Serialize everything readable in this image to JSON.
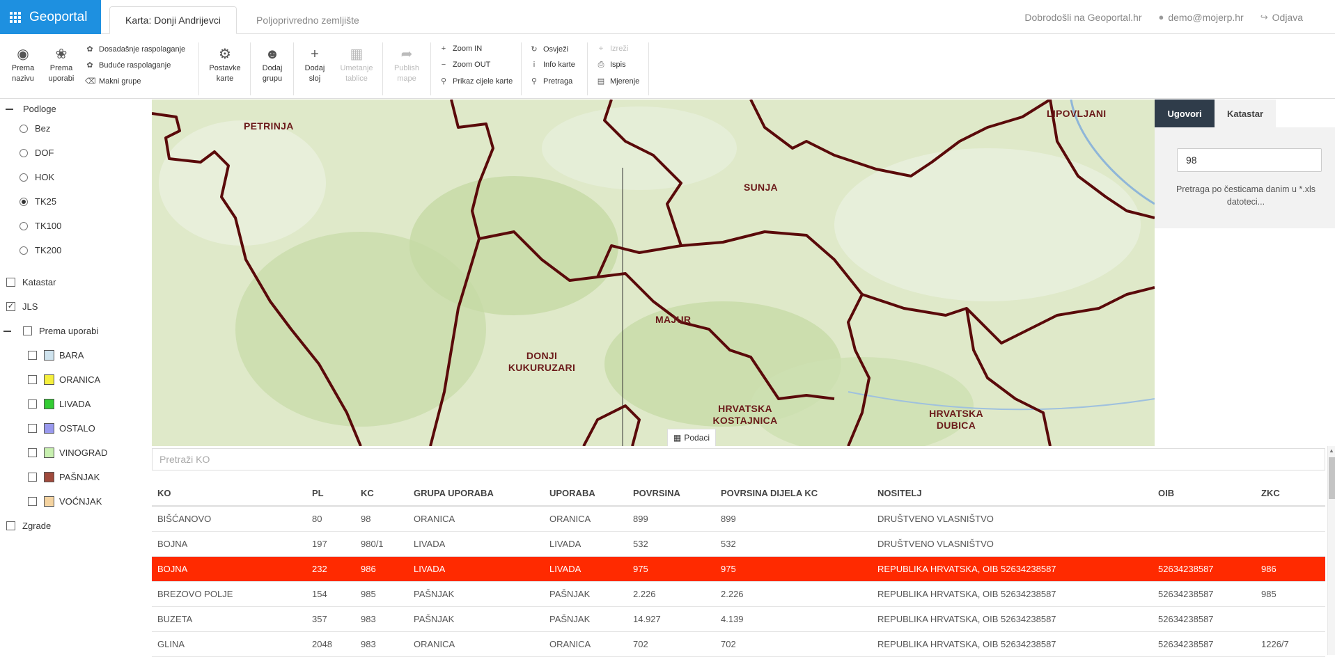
{
  "header": {
    "brand": "Geoportal",
    "tabs": [
      {
        "label": "Karta: Donji Andrijevci",
        "active": true
      },
      {
        "label": "Poljoprivredno zemljište",
        "active": false
      }
    ],
    "welcome": "Dobrodošli na Geoportal.hr",
    "user": "demo@mojerp.hr",
    "logout": "Odjava"
  },
  "toolbar": {
    "prema_nazivu": [
      "Prema",
      "nazivu"
    ],
    "prema_uporabi": [
      "Prema",
      "uporabi"
    ],
    "dosadasnje": "Dosadašnje raspolaganje",
    "buduce": "Buduće raspolaganje",
    "makni": "Makni grupe",
    "postavke": [
      "Postavke",
      "karte"
    ],
    "dodaj_grupu": [
      "Dodaj",
      "grupu"
    ],
    "dodaj_sloj": [
      "Dodaj",
      "sloj"
    ],
    "umetanje": [
      "Umetanje",
      "tablice"
    ],
    "publish": [
      "Publish",
      "mape"
    ],
    "zoom_in": "Zoom IN",
    "zoom_out": "Zoom OUT",
    "prikaz": "Prikaz cijele karte",
    "osvjezi": "Osvježi",
    "info": "Info karte",
    "pretraga": "Pretraga",
    "izrezi": "Izreži",
    "ispis": "Ispis",
    "mjerenje": "Mjerenje"
  },
  "layers": {
    "podloge_label": "Podloge",
    "basemaps": [
      {
        "label": "Bez",
        "selected": false
      },
      {
        "label": "DOF",
        "selected": false
      },
      {
        "label": "HOK",
        "selected": false
      },
      {
        "label": "TK25",
        "selected": true
      },
      {
        "label": "TK100",
        "selected": false
      },
      {
        "label": "TK200",
        "selected": false
      }
    ],
    "katastar": "Katastar",
    "jls": "JLS",
    "prema_uporabi": "Prema uporabi",
    "uporabe": [
      {
        "label": "BARA",
        "color": "#cfe3ee"
      },
      {
        "label": "ORANICA",
        "color": "#f5ef3d"
      },
      {
        "label": "LIVADA",
        "color": "#33cc33"
      },
      {
        "label": "OSTALO",
        "color": "#9999ee"
      },
      {
        "label": "VINOGRAD",
        "color": "#c8f0b0"
      },
      {
        "label": "PAŠNJAK",
        "color": "#a04a3c"
      },
      {
        "label": "VOĆNJAK",
        "color": "#f4d3a0"
      }
    ],
    "zgrade": "Zgrade"
  },
  "map": {
    "labels": {
      "petrinja": "PETRINJA",
      "sunja": "SUNJA",
      "lipovljani": "LIPOVLJANI",
      "majur": "MAJUR",
      "donji_1": "DONJI",
      "donji_2": "KUKURUZARI",
      "hk_1": "HRVATSKA",
      "hk_2": "KOSTAJNICA",
      "hd_1": "HRVATSKA",
      "hd_2": "DUBICA"
    },
    "podaci": "Podaci"
  },
  "right_panel": {
    "tab_ugovori": "Ugovori",
    "tab_katastar": "Katastar",
    "search_value": "98",
    "hint": "Pretraga po česticama danim u *.xls datoteci..."
  },
  "table": {
    "search_placeholder": "Pretraži KO",
    "columns": [
      "KO",
      "PL",
      "KC",
      "GRUPA UPORABA",
      "UPORABA",
      "POVRSINA",
      "POVRSINA DIJELA KC",
      "NOSITELJ",
      "OIB",
      "ZKC"
    ],
    "rows": [
      [
        "BIŠĆANOVO",
        "80",
        "98",
        "ORANICA",
        "ORANICA",
        "899",
        "899",
        "DRUŠTVENO VLASNIŠTVO",
        "",
        ""
      ],
      [
        "BOJNA",
        "197",
        "980/1",
        "LIVADA",
        "LIVADA",
        "532",
        "532",
        "DRUŠTVENO VLASNIŠTVO",
        "",
        ""
      ],
      [
        "BOJNA",
        "232",
        "986",
        "LIVADA",
        "LIVADA",
        "975",
        "975",
        "REPUBLIKA HRVATSKA, OIB 52634238587",
        "52634238587",
        "986"
      ],
      [
        "BREZOVO POLJE",
        "154",
        "985",
        "PAŠNJAK",
        "PAŠNJAK",
        "2.226",
        "2.226",
        "REPUBLIKA HRVATSKA, OIB 52634238587",
        "52634238587",
        "985"
      ],
      [
        "BUZETA",
        "357",
        "983",
        "PAŠNJAK",
        "PAŠNJAK",
        "14.927",
        "4.139",
        "REPUBLIKA HRVATSKA, OIB 52634238587",
        "52634238587",
        ""
      ],
      [
        "GLINA",
        "2048",
        "983",
        "ORANICA",
        "ORANICA",
        "702",
        "702",
        "REPUBLIKA HRVATSKA, OIB 52634238587",
        "52634238587",
        "1226/7"
      ]
    ],
    "selected_row": 2
  },
  "colors": {
    "brand": "#1e90e0",
    "selected_row": "#ff2a00",
    "boundary": "#5a0a0a",
    "active_tab": "#2f3c4a"
  }
}
